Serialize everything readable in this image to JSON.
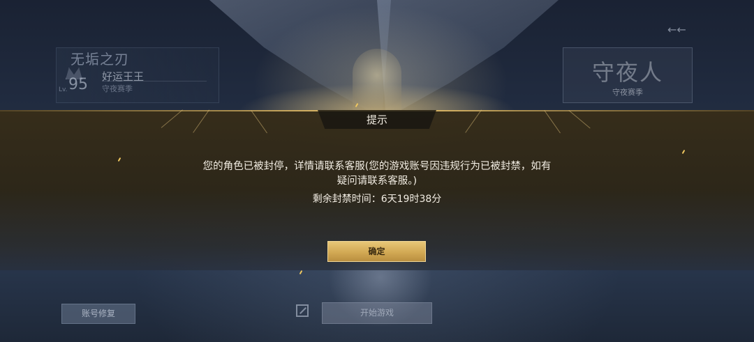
{
  "profile": {
    "mode_title": "无垢之刃",
    "level_prefix": "Lv.",
    "level": "95",
    "player_name": "好运王王",
    "season_label": "守夜赛季"
  },
  "season_card": {
    "title": "守夜人",
    "subtitle": "守夜赛季"
  },
  "back_icon": "back-arrow-icon",
  "dialog": {
    "title": "提示",
    "message": "您的角色已被封停，详情请联系客服(您的游戏账号因违规行为已被封禁，如有疑问请联系客服。)",
    "remaining_label": "剩余封禁时间：6天19时38分",
    "confirm_label": "确定"
  },
  "bottom": {
    "repair_label": "账号修复",
    "swap_icon": "swap-icon",
    "start_label": "开始游戏"
  },
  "colors": {
    "accent_gold": "#d2a954",
    "dialog_bg": "#2d2616"
  }
}
